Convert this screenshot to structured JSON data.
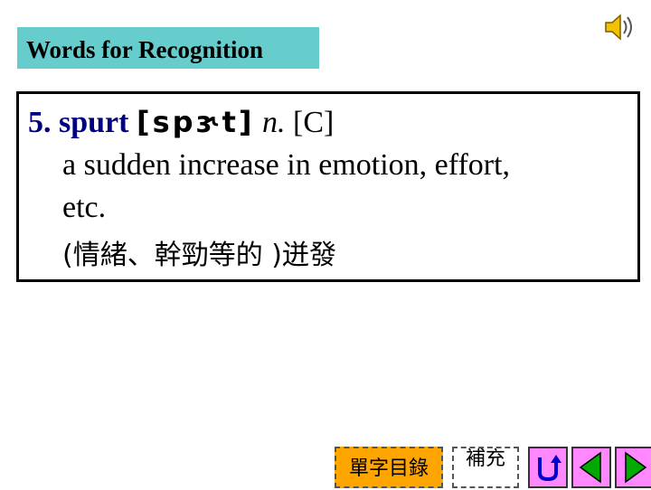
{
  "header": {
    "title": "Words for Recognition"
  },
  "entry": {
    "number_word": "5. spurt",
    "phonetic": "[spɝt]",
    "pos": "n.",
    "grammar": "[C]",
    "definition_line1": "a sudden increase in emotion, effort,",
    "definition_line2": "etc.",
    "translation": "(情緒、幹勁等的 )迸發"
  },
  "nav": {
    "vocab_list_label": "單字目錄",
    "supplement_label": "補充"
  },
  "colors": {
    "header_bg": "#66cccc",
    "headword": "#000080",
    "vocab_button_bg": "#ffa500",
    "nav_button_bg": "#ff88ff"
  },
  "icons": [
    "speaker-icon",
    "return-icon",
    "left-arrow-icon",
    "right-arrow-icon"
  ]
}
